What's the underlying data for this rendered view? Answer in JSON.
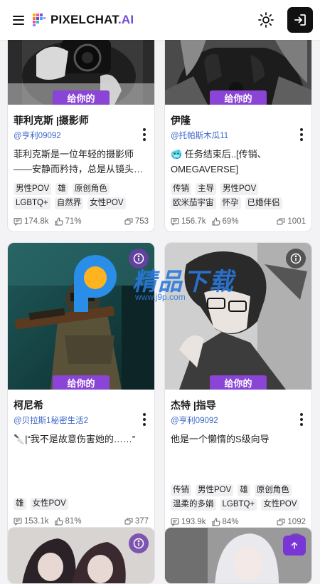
{
  "header": {
    "logo_main": "PIXELCHAT",
    "logo_suffix": ".AI",
    "theme_icon": "sun-icon",
    "login_icon": "login-icon"
  },
  "badge_label": "给你的",
  "cards": [
    {
      "title": "菲利克斯 |摄影师",
      "author": "@亨利09092",
      "description": "菲利克斯是一位年轻的摄影师——安静而矜持，总是从镜头…",
      "tags": [
        "男性POV",
        "雄",
        "原创角色",
        "LGBTQ+",
        "自然界",
        "女性POV"
      ],
      "messages": "174.8k",
      "likes": "71%",
      "chats": "753"
    },
    {
      "title": "伊隆",
      "author": "@托帕斯木瓜11",
      "description": "🥶 任务结束后..[传销、OMEGAVERSE]",
      "tags": [
        "传销",
        "主导",
        "男性POV",
        "欧米茄宇宙",
        "怀孕",
        "已婚伴侣"
      ],
      "messages": "156.7k",
      "likes": "69%",
      "chats": "1001"
    },
    {
      "title": "柯尼希",
      "author": "@贝拉斯1秘密生活2",
      "description": "🔪|“我不是故意伤害她的……”",
      "tags": [
        "雄",
        "女性POV"
      ],
      "messages": "153.1k",
      "likes": "81%",
      "chats": "377"
    },
    {
      "title": "杰特 |指导",
      "author": "@亨利09092",
      "description": "他是一个懒惰的S级向导",
      "tags": [
        "传销",
        "男性POV",
        "雄",
        "原创角色",
        "温柔的多娟",
        "LGBTQ+",
        "女性POV"
      ],
      "messages": "193.9k",
      "likes": "84%",
      "chats": "1092"
    }
  ],
  "watermark": {
    "text": "精品下载",
    "url": "www.j9p.com"
  },
  "colors": {
    "accent": "#8a44d6",
    "author_link": "#3a63c6",
    "login_button": "#111111"
  }
}
